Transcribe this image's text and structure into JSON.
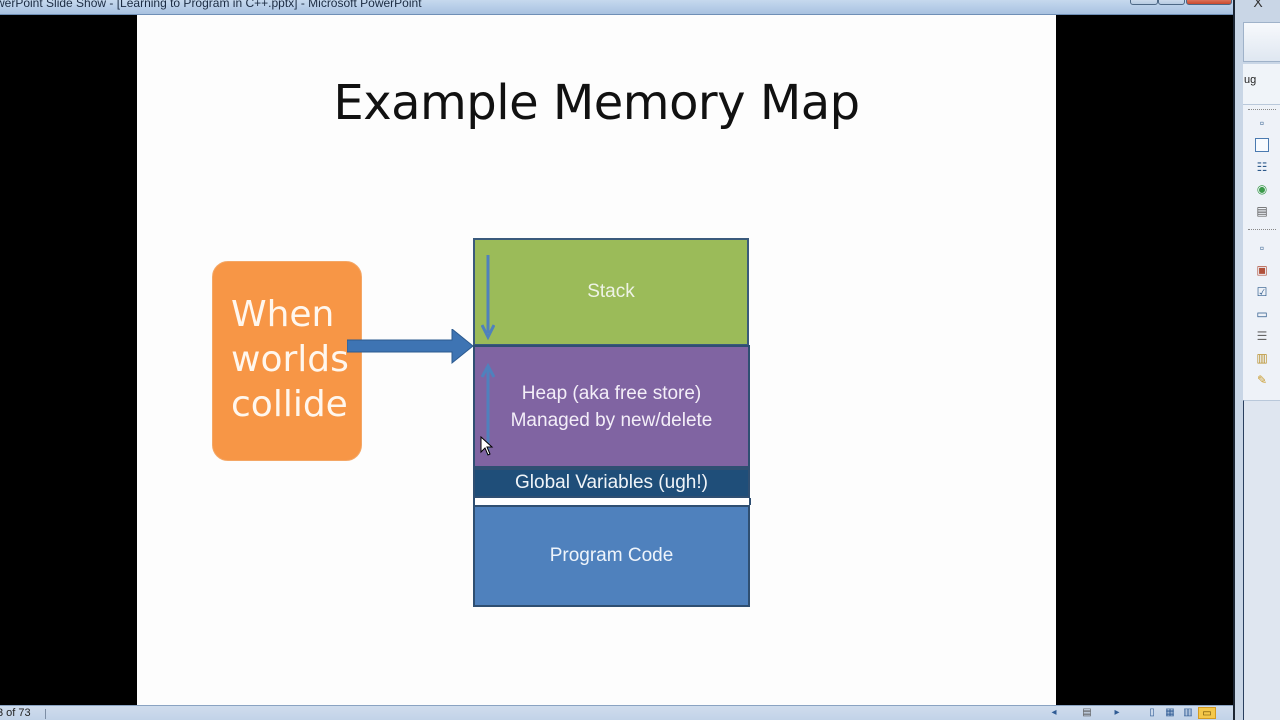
{
  "window": {
    "title": "werPoint Slide Show - [Learning to Program in C++.pptx] - Microsoft PowerPoint",
    "close_glyph": "X"
  },
  "slide": {
    "title": "Example Memory Map",
    "callout": [
      "When",
      "worlds",
      "collide"
    ],
    "memory_map": {
      "stack": "Stack",
      "heap_line1": "Heap (aka free store)",
      "heap_line2": "Managed by new/delete",
      "globals": "Global Variables (ugh!)",
      "code": "Program Code"
    },
    "colors": {
      "callout": "#f79646",
      "arrow": "#3e74b3",
      "stack": "#9bbb59",
      "heap": "#8064a2",
      "globals": "#1f4e79",
      "code": "#4f81bd"
    }
  },
  "right_pane": {
    "label": "ug",
    "icons": [
      "restore-icon",
      "window-icon",
      "outline-icon",
      "target-icon",
      "document-icon",
      "restore-icon",
      "picture-icon",
      "checklist-icon",
      "monitor-icon",
      "list-icon",
      "clipboard-icon",
      "wand-icon"
    ]
  },
  "status_bar": {
    "slide_counter": "3 of 73",
    "prev_glyph": "◂",
    "menu_glyph": "▤",
    "next_glyph": "▸"
  }
}
